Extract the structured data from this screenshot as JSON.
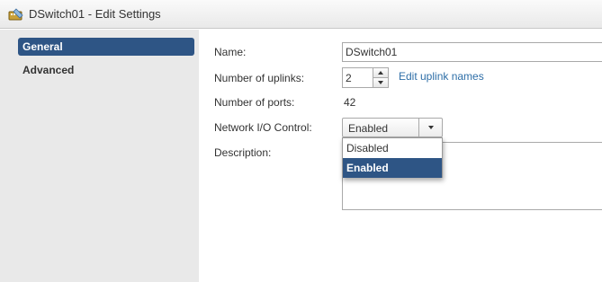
{
  "window": {
    "title": "DSwitch01 - Edit Settings",
    "icon": "distributed-switch-icon"
  },
  "sidebar": {
    "items": [
      {
        "label": "General",
        "selected": true
      },
      {
        "label": "Advanced",
        "selected": false
      }
    ]
  },
  "form": {
    "name_label": "Name:",
    "name_value": "DSwitch01",
    "uplinks_label": "Number of uplinks:",
    "uplinks_value": "2",
    "edit_uplink_link": "Edit uplink names",
    "ports_label": "Number of ports:",
    "ports_value": "42",
    "nioc_label": "Network I/O Control:",
    "nioc_value": "Enabled",
    "nioc_options": [
      {
        "label": "Disabled",
        "highlighted": false
      },
      {
        "label": "Enabled",
        "highlighted": true
      }
    ],
    "description_label": "Description:",
    "description_value": ""
  },
  "colors": {
    "selection": "#2e5585",
    "link": "#2e6ea7",
    "sidebar_bg": "#e9e9e9"
  }
}
